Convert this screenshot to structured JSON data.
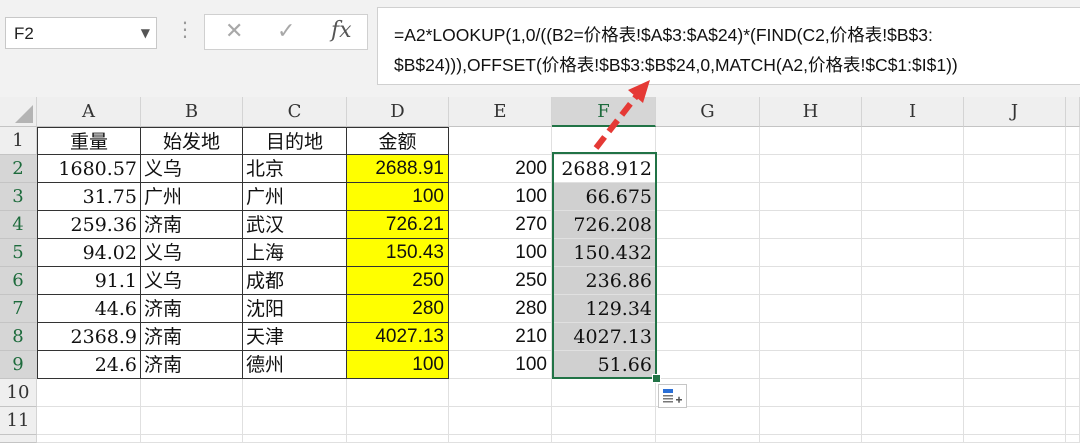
{
  "namebox": {
    "value": "F2"
  },
  "formula_bar": {
    "cancel_icon": "close-icon",
    "enter_icon": "check-icon",
    "fx_label": "fx",
    "line1": "=A2*LOOKUP(1,0/((B2=价格表!$A$3:$A$24)*(FIND(C2,价格表!$B$3:",
    "line2": "$B$24))),OFFSET(价格表!$B$3:$B$24,0,MATCH(A2,价格表!$C$1:$I$1))"
  },
  "columns": [
    "A",
    "B",
    "C",
    "D",
    "E",
    "F",
    "G",
    "H",
    "I",
    "J"
  ],
  "rows": [
    "1",
    "2",
    "3",
    "4",
    "5",
    "6",
    "7",
    "8",
    "9",
    "10",
    "11"
  ],
  "header_row": {
    "A": "重量",
    "B": "始发地",
    "C": "目的地",
    "D": "金额"
  },
  "data": [
    {
      "A": "1680.57",
      "B": "义乌",
      "C": "北京",
      "D": "2688.91",
      "E": "200",
      "F": "2688.912"
    },
    {
      "A": "31.75",
      "B": "广州",
      "C": "广州",
      "D": "100",
      "E": "100",
      "F": "66.675"
    },
    {
      "A": "259.36",
      "B": "济南",
      "C": "武汉",
      "D": "726.21",
      "E": "270",
      "F": "726.208"
    },
    {
      "A": "94.02",
      "B": "义乌",
      "C": "上海",
      "D": "150.43",
      "E": "100",
      "F": "150.432"
    },
    {
      "A": "91.1",
      "B": "义乌",
      "C": "成都",
      "D": "250",
      "E": "250",
      "F": "236.86"
    },
    {
      "A": "44.6",
      "B": "济南",
      "C": "沈阳",
      "D": "280",
      "E": "280",
      "F": "129.34"
    },
    {
      "A": "2368.9",
      "B": "济南",
      "C": "天津",
      "D": "4027.13",
      "E": "210",
      "F": "4027.13"
    },
    {
      "A": "24.6",
      "B": "济南",
      "C": "德州",
      "D": "100",
      "E": "100",
      "F": "51.66"
    }
  ],
  "colors": {
    "selection": "#217346",
    "highlight": "#ffff00",
    "arrow": "#e53935"
  },
  "quick_analysis_icon": "quick-analysis-icon"
}
